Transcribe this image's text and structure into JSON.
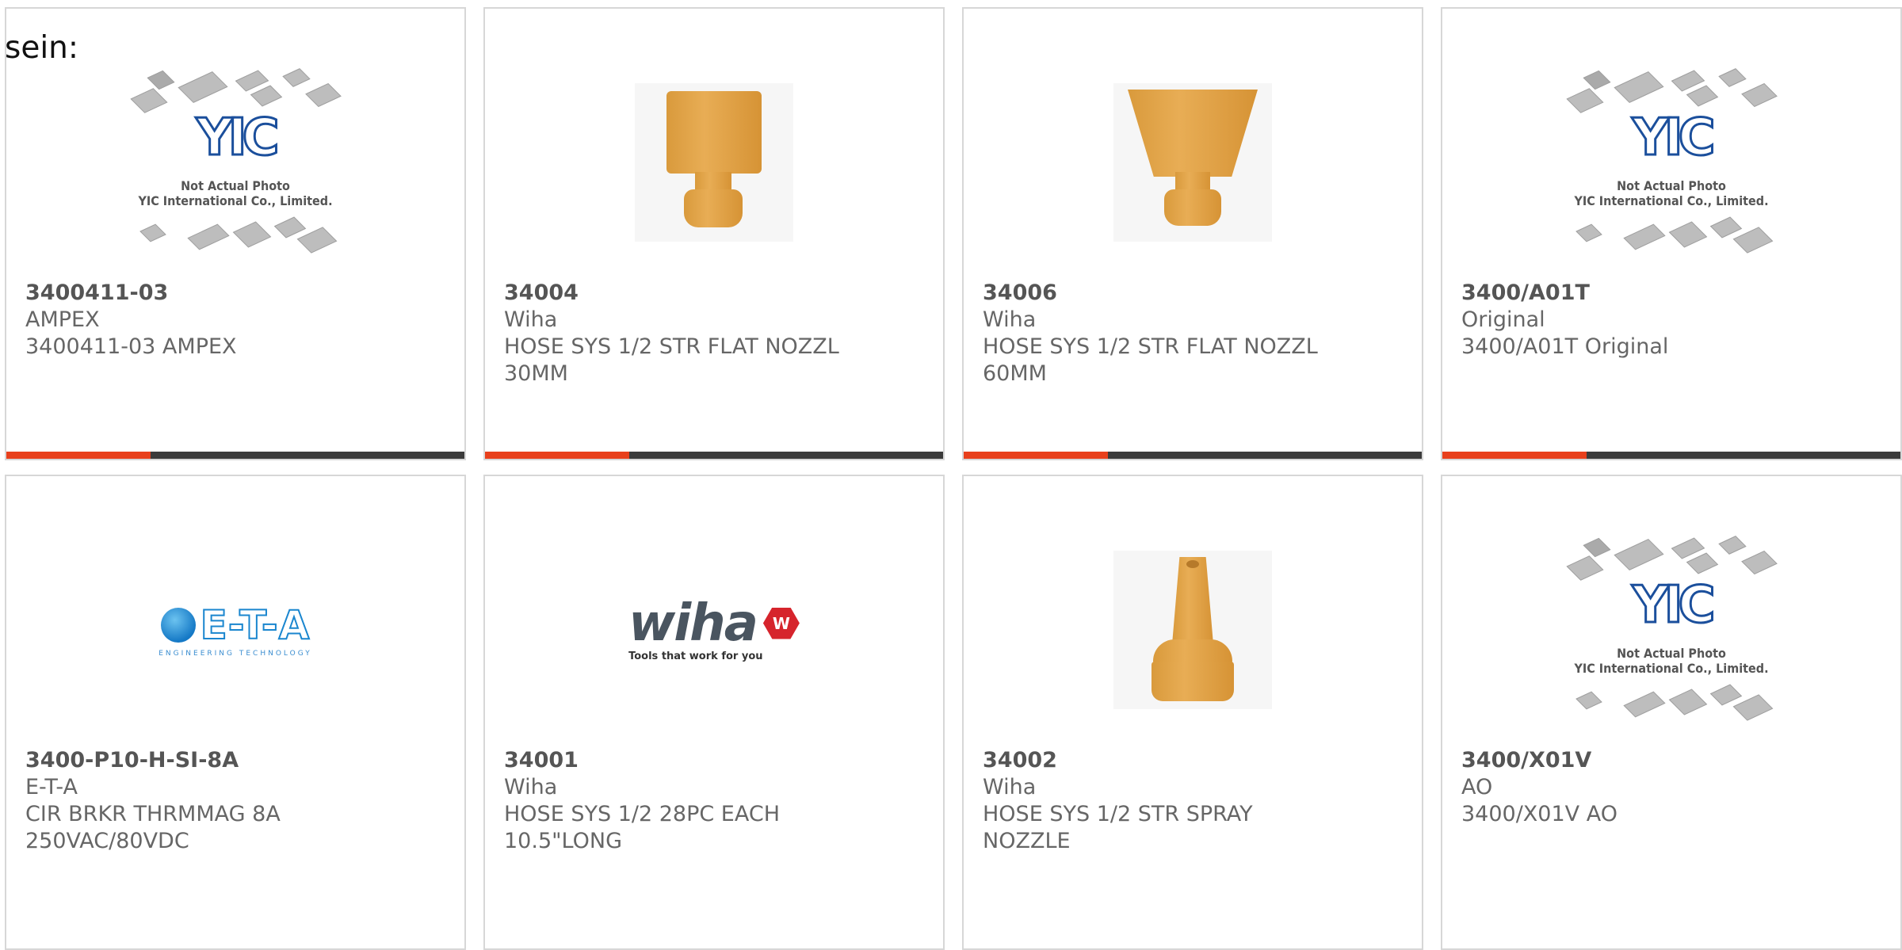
{
  "page": {
    "fragment_text": "sein:"
  },
  "placeholder_image": {
    "caption_line1": "Not Actual Photo",
    "caption_line2": "YIC International Co., Limited.",
    "logo_text": "YIC"
  },
  "brand_logos": {
    "eta": {
      "wordmark": "E-T-A",
      "tagline": "ENGINEERING TECHNOLOGY"
    },
    "wiha": {
      "wordmark": "wiha",
      "badge": "W",
      "tagline": "Tools that work for you"
    }
  },
  "colors": {
    "accent": "#e8401c",
    "bar": "#3b3b3b",
    "border": "#d7d7d7",
    "text": "#666666"
  },
  "products": [
    {
      "part_number": "3400411-03",
      "manufacturer": "AMPEX",
      "description_lines": [
        "3400411-03 AMPEX"
      ],
      "image": "placeholder"
    },
    {
      "part_number": "34004",
      "manufacturer": "Wiha",
      "description_lines": [
        "HOSE SYS 1/2 STR FLAT NOZZL",
        "30MM"
      ],
      "image": "flat-nozzle-30"
    },
    {
      "part_number": "34006",
      "manufacturer": "Wiha",
      "description_lines": [
        "HOSE SYS 1/2 STR FLAT NOZZL",
        "60MM"
      ],
      "image": "flat-nozzle-60"
    },
    {
      "part_number": "3400/A01T",
      "manufacturer": "Original",
      "description_lines": [
        "3400/A01T Original"
      ],
      "image": "placeholder"
    },
    {
      "part_number": "3400-P10-H-SI-8A",
      "manufacturer": "E-T-A",
      "description_lines": [
        "CIR BRKR THRMMAG 8A",
        "250VAC/80VDC"
      ],
      "image": "eta-logo"
    },
    {
      "part_number": "34001",
      "manufacturer": "Wiha",
      "description_lines": [
        "HOSE SYS 1/2 28PC EACH",
        "10.5\"LONG"
      ],
      "image": "wiha-logo"
    },
    {
      "part_number": "34002",
      "manufacturer": "Wiha",
      "description_lines": [
        "HOSE SYS 1/2 STR SPRAY",
        "NOZZLE"
      ],
      "image": "spray-nozzle"
    },
    {
      "part_number": "3400/X01V",
      "manufacturer": "AO",
      "description_lines": [
        "3400/X01V AO"
      ],
      "image": "placeholder"
    }
  ]
}
